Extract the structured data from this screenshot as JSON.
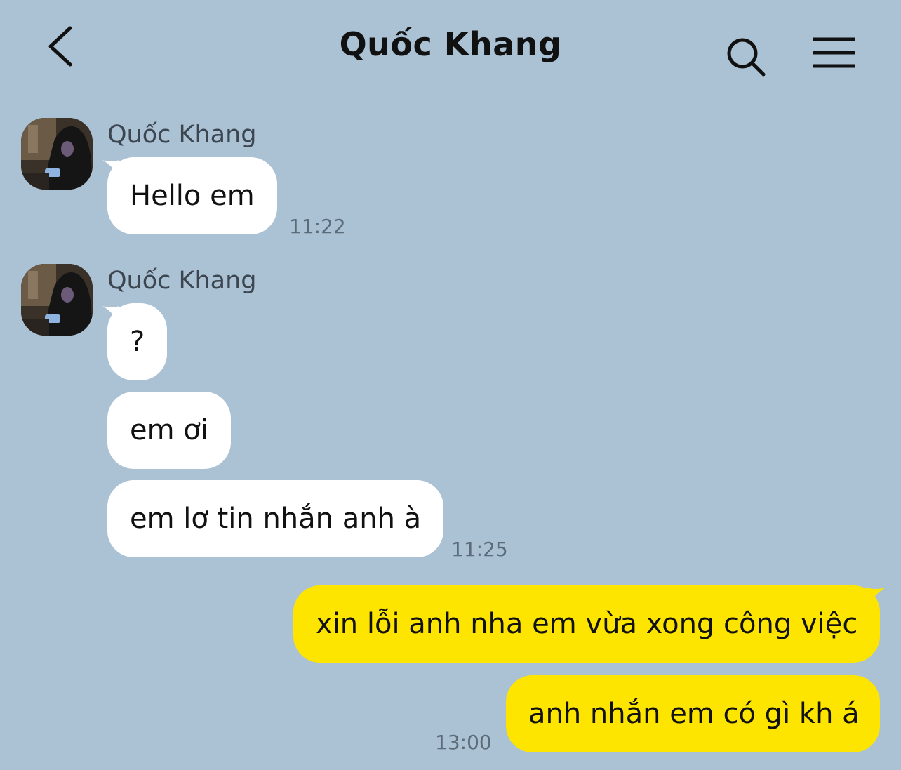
{
  "header": {
    "back_icon": "chevron-left-icon",
    "title": "Quốc Khang",
    "search_icon": "search-icon",
    "menu_icon": "hamburger-menu-icon"
  },
  "colors": {
    "background": "#abc1d4",
    "incoming_bubble": "#ffffff",
    "outgoing_bubble": "#fee500"
  },
  "messages": {
    "group1": {
      "sender": "Quốc Khang",
      "bubbles": [
        "Hello em"
      ],
      "time": "11:22"
    },
    "group2": {
      "sender": "Quốc Khang",
      "bubbles": [
        "?",
        "em ơi",
        "em lơ tin nhắn anh à"
      ],
      "time": "11:25"
    },
    "group3": {
      "bubbles": [
        "xin lỗi anh nha em vừa xong công việc",
        "anh nhắn em có gì kh á"
      ],
      "time": "13:00"
    }
  }
}
